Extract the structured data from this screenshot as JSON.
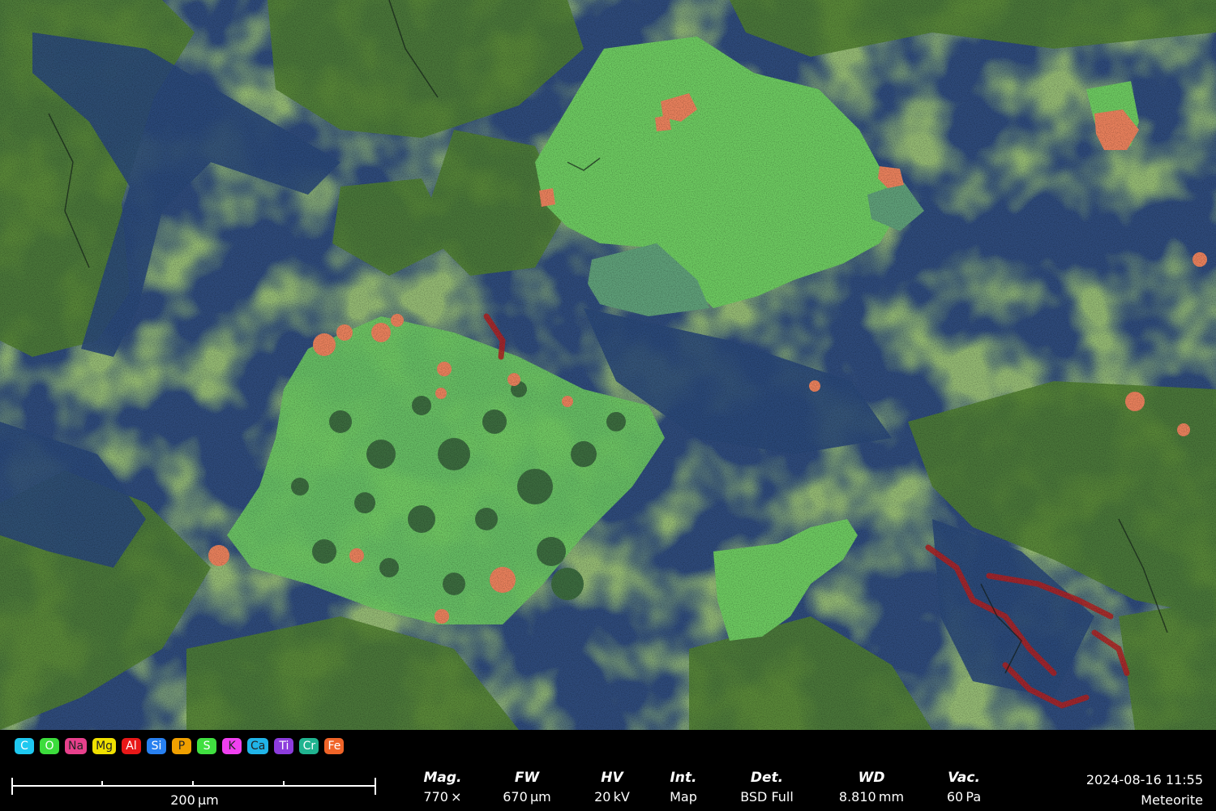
{
  "legend": [
    {
      "label": "C",
      "color": "#1ec8f0",
      "text_color": "#ffffff"
    },
    {
      "label": "O",
      "color": "#3cdc3c",
      "text_color": "#ffffff"
    },
    {
      "label": "Na",
      "color": "#e8408c",
      "text_color": "#222222"
    },
    {
      "label": "Mg",
      "color": "#f0e000",
      "text_color": "#222222"
    },
    {
      "label": "Al",
      "color": "#e81818",
      "text_color": "#ffffff"
    },
    {
      "label": "Si",
      "color": "#2880f0",
      "text_color": "#ffffff"
    },
    {
      "label": "P",
      "color": "#f0a000",
      "text_color": "#222222"
    },
    {
      "label": "S",
      "color": "#40e040",
      "text_color": "#ffffff"
    },
    {
      "label": "K",
      "color": "#f040f0",
      "text_color": "#222222"
    },
    {
      "label": "Ca",
      "color": "#20b4e8",
      "text_color": "#222222"
    },
    {
      "label": "Ti",
      "color": "#8c3cdc",
      "text_color": "#ffffff"
    },
    {
      "label": "Cr",
      "color": "#20b490",
      "text_color": "#ffffff"
    },
    {
      "label": "Fe",
      "color": "#f06428",
      "text_color": "#ffffff"
    }
  ],
  "scale_bar": {
    "label": "200 μm"
  },
  "params": [
    {
      "key": "Mag.",
      "value": "770 ×"
    },
    {
      "key": "FW",
      "value": "670 μm"
    },
    {
      "key": "HV",
      "value": "20 kV"
    },
    {
      "key": "Int.",
      "value": "Map"
    },
    {
      "key": "Det.",
      "value": "BSD Full"
    },
    {
      "key": "WD",
      "value": "8.810 mm"
    },
    {
      "key": "Vac.",
      "value": "60 Pa"
    }
  ],
  "datetime": "2024-08-16 11:55",
  "sample_name": "Meteorite",
  "colors": {
    "matrix_blue": "#2e4a7a",
    "matrix_green": "#4a7a2c",
    "olivine_green": "#6cc860",
    "pale_green": "#5e9e78",
    "sulfide_salmon": "#e8805c",
    "red_phase": "#b02020"
  }
}
